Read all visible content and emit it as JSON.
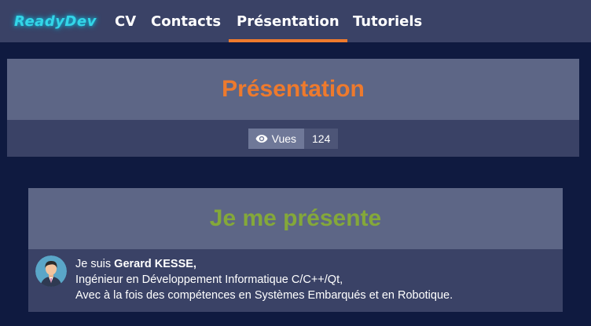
{
  "navbar": {
    "logo": "ReadyDev",
    "items": [
      {
        "label": "CV"
      },
      {
        "label": "Contacts"
      },
      {
        "label": "Présentation",
        "active": true
      },
      {
        "label": "Tutoriels"
      }
    ]
  },
  "header": {
    "title": "Présentation",
    "views_label": "Vues",
    "views_count": "124",
    "views_icon": "eye-icon"
  },
  "card": {
    "title": "Je me présente",
    "intro_prefix": "Je suis ",
    "name": "Gerard KESSE,",
    "line2": "Ingénieur en Développement Informatique C/C++/Qt,",
    "line3": "Avec à la fois des compétences en Systèmes Embarqués et en Robotique."
  },
  "colors": {
    "accent": "#ee7a2d",
    "card_title": "#84a83a",
    "logo": "#33d6e8",
    "background": "#0f1a40"
  }
}
